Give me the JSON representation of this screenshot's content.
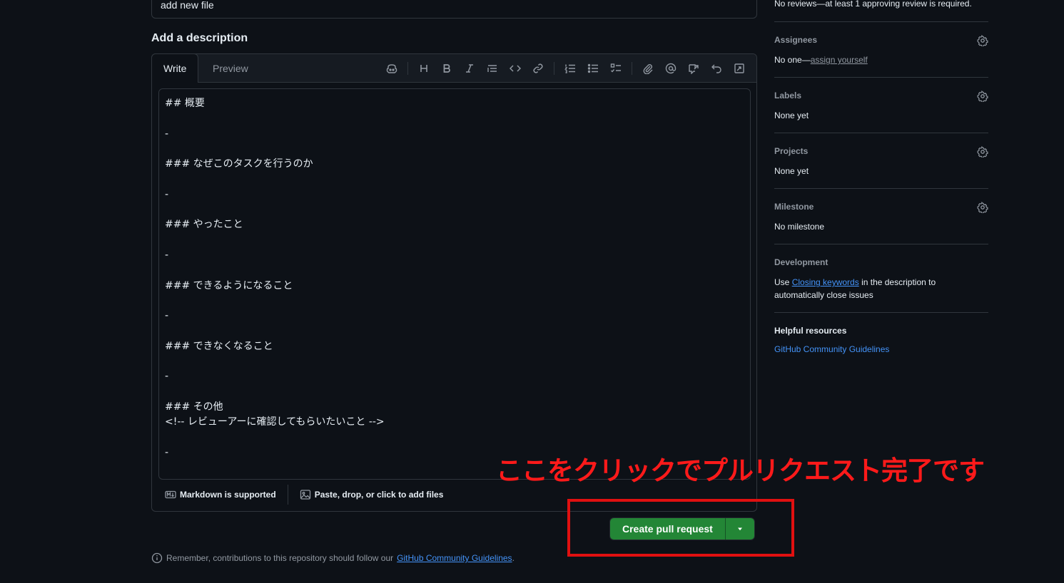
{
  "title_input": {
    "value": "add new file"
  },
  "description": {
    "heading": "Add a description",
    "tabs": {
      "write": "Write",
      "preview": "Preview"
    },
    "toolbar": [
      "copilot-icon",
      "heading-icon",
      "bold-icon",
      "italic-icon",
      "quote-icon",
      "code-icon",
      "link-icon",
      "ordered-list-icon",
      "unordered-list-icon",
      "task-list-icon",
      "attach-icon",
      "mention-icon",
      "reference-icon",
      "undo-icon",
      "fullscreen-icon"
    ],
    "body_lines": [
      "## 概要",
      "",
      "-",
      "",
      "### なぜこのタスクを行うのか",
      "",
      "-",
      "",
      "### やったこと",
      "",
      "-",
      "",
      "### できるようになること",
      "",
      "-",
      "",
      "### できなくなること",
      "",
      "-",
      "",
      "### その他",
      "<!-- レビューアーに確認してもらいたいこと -->",
      "",
      "-"
    ],
    "footer": {
      "markdown": "Markdown is supported",
      "attach": "Paste, drop, or click to add files"
    }
  },
  "annotation": "ここをクリックでプルリクエスト完了です",
  "create_button": {
    "label": "Create pull request"
  },
  "remember": {
    "prefix": "Remember, contributions to this repository should follow our",
    "link": "GitHub Community Guidelines",
    "suffix": "."
  },
  "sidebar": {
    "reviewers_note": "No reviews—at least 1 approving review is required.",
    "assignees": {
      "title": "Assignees",
      "prefix": "No one—",
      "link": "assign yourself"
    },
    "labels": {
      "title": "Labels",
      "value": "None yet"
    },
    "projects": {
      "title": "Projects",
      "value": "None yet"
    },
    "milestone": {
      "title": "Milestone",
      "value": "No milestone"
    },
    "development": {
      "title": "Development",
      "prefix": "Use ",
      "link": "Closing keywords",
      "suffix": " in the description to automatically close issues"
    },
    "helpful": {
      "title": "Helpful resources",
      "link": "GitHub Community Guidelines"
    }
  }
}
